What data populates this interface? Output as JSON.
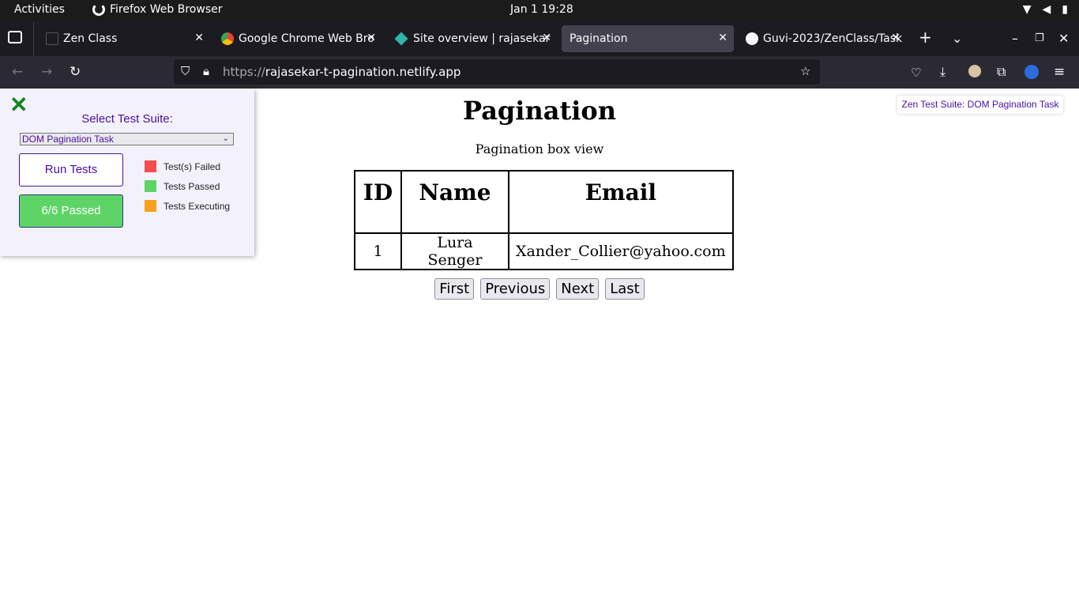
{
  "system_bar": {
    "activities": "Activities",
    "app_name": "Firefox Web Browser",
    "clock": "Jan 1  19:28"
  },
  "tabs": [
    {
      "title": "Zen Class",
      "icon": "document-icon"
    },
    {
      "title": "Google Chrome Web Bro",
      "icon": "chrome-icon"
    },
    {
      "title": "Site overview | rajasekar",
      "icon": "netlify-icon"
    },
    {
      "title": "Pagination",
      "icon": "none",
      "active": true
    },
    {
      "title": "Guvi-2023/ZenClass/Task",
      "icon": "github-icon"
    }
  ],
  "address_bar": {
    "scheme": "https://",
    "host": "rajasekar-t-pagination.netlify.app"
  },
  "page": {
    "title": "Pagination",
    "subtitle": "Pagination box view",
    "table": {
      "headers": [
        "ID",
        "Name",
        "Email"
      ],
      "rows": [
        [
          "1",
          "Lura Senger",
          "Xander_Collier@yahoo.com"
        ]
      ]
    },
    "pager": [
      "First",
      "Previous",
      "Next",
      "Last"
    ]
  },
  "test_panel": {
    "select_label": "Select Test Suite:",
    "selected_suite": "DOM Pagination Task",
    "run_button": "Run Tests",
    "result_button": "6/6 Passed",
    "legend": [
      {
        "label": "Test(s) Failed",
        "color": "#f44d4d"
      },
      {
        "label": "Tests Passed",
        "color": "#5fd466"
      },
      {
        "label": "Tests Executing",
        "color": "#f7a01c"
      }
    ]
  },
  "suite_badge": "Zen Test Suite: DOM Pagination Task",
  "colors": {
    "accent": "#4b0fa0",
    "pass": "#5fd466",
    "close": "#12851f"
  }
}
